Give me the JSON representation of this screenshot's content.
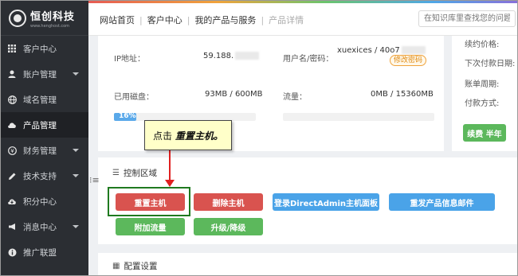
{
  "logo": {
    "title": "恒创科技",
    "sub": "www.henghost.com"
  },
  "sidebar": {
    "items": [
      {
        "label": "客户中心",
        "icon": "grid-icon",
        "caret": false,
        "active": false
      },
      {
        "label": "账户管理",
        "icon": "user-icon",
        "caret": true,
        "active": false
      },
      {
        "label": "域名管理",
        "icon": "globe-icon",
        "caret": false,
        "active": false
      },
      {
        "label": "产品管理",
        "icon": "cloud-icon",
        "caret": false,
        "active": true
      },
      {
        "label": "财务管理",
        "icon": "yen-icon",
        "caret": true,
        "active": false
      },
      {
        "label": "技术支持",
        "icon": "pencil-icon",
        "caret": true,
        "active": false
      },
      {
        "label": "积分中心",
        "icon": "cloud-download-icon",
        "caret": false,
        "active": false
      },
      {
        "label": "消息中心",
        "icon": "megaphone-icon",
        "caret": true,
        "active": false
      },
      {
        "label": "推广联盟",
        "icon": "info-icon",
        "caret": false,
        "active": false
      }
    ]
  },
  "header": {
    "crumbs": [
      "网站首页",
      "客户中心",
      "我的产品与服务",
      "产品详情"
    ],
    "search_placeholder": "在知识库里查找您的问题"
  },
  "info": {
    "ip_label": "IP地址：",
    "ip_value": "59.188.",
    "account_label": "用户名/密码：",
    "account_value": "xuexices / 40o7",
    "modify_label": "修改密码",
    "disk_label": "已用磁盘：",
    "disk_value": "93MB / 600MB",
    "disk_percent_text": "16%",
    "disk_percent": 0.16,
    "traffic_label": "流量：",
    "traffic_value": "0MB / 15360MB",
    "traffic_percent": 0.0
  },
  "side": {
    "labels": [
      "续约价格:",
      "下次付款日期:",
      "账单周期:",
      "付款方式:"
    ],
    "renew_button": "续费 半年"
  },
  "control": {
    "title": "控制区域",
    "buttons": {
      "restart": "重置主机",
      "delete": "删除主机",
      "login_da": "登录DirectAdmin主机面板",
      "resend": "重发产品信息邮件",
      "add_traffic": "附加流量",
      "upgrade": "升级/降级"
    }
  },
  "config": {
    "title": "配置设置"
  },
  "tooltip": {
    "prefix": "点击",
    "action": "重置主机。"
  },
  "colors": {
    "red": "#d9534f",
    "blue": "#4aa3e8",
    "green": "#5cb85c",
    "sidebar": "#2b2e33"
  }
}
